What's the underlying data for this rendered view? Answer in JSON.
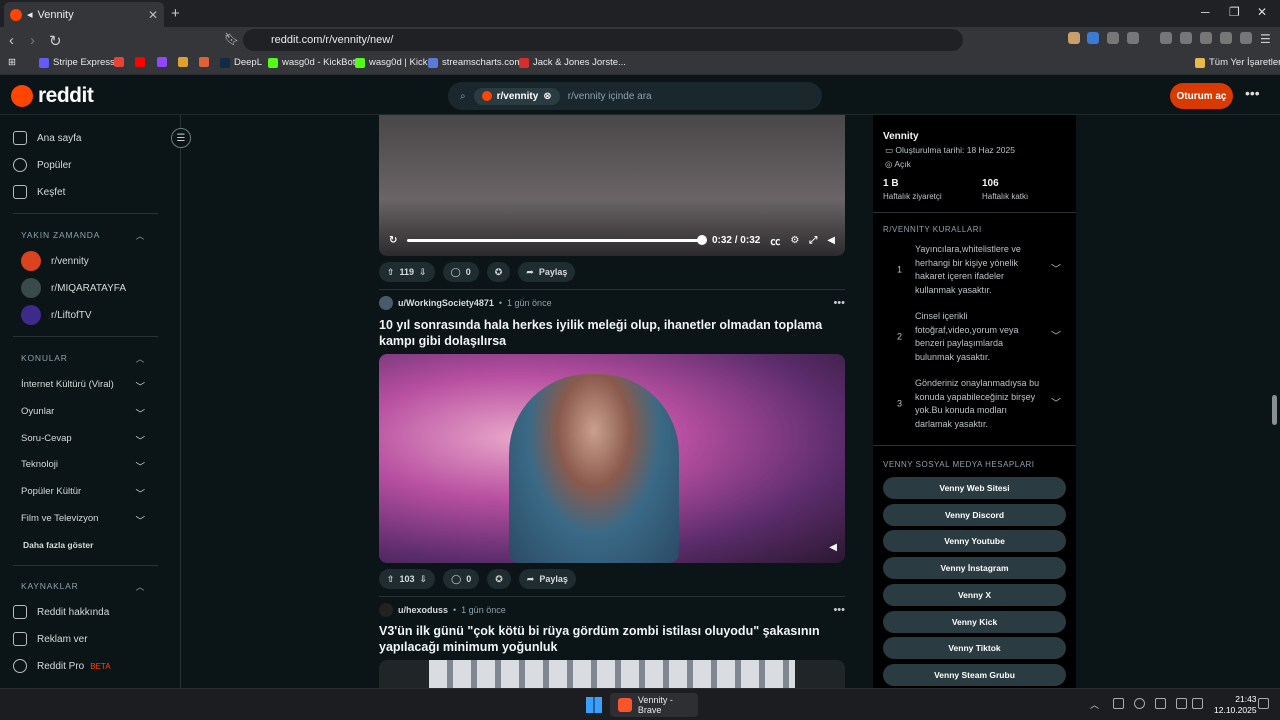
{
  "browser": {
    "tab_title": "Vennity",
    "url": "reddit.com/r/vennity/new/",
    "bookmarks": [
      "Stripe Express",
      "DeepL",
      "wasg0d - KickBot",
      "wasg0d | Kick",
      "streamscharts.com",
      "Jack & Jones Jorste...",
      "Tüm Yer İşaretleri"
    ]
  },
  "header": {
    "logo_text": "reddit",
    "search_chip": "r/vennity",
    "search_placeholder": "r/vennity içinde ara",
    "login_label": "Oturum aç"
  },
  "sidebar": {
    "nav": [
      "Ana sayfa",
      "Popüler",
      "Keşfet"
    ],
    "recent_title": "YAKIN ZAMANDA",
    "recent": [
      "r/vennity",
      "r/MIQARATAYFA",
      "r/LiftofTV"
    ],
    "topics_title": "KONULAR",
    "topics": [
      "İnternet Kültürü (Viral)",
      "Oyunlar",
      "Soru-Cevap",
      "Teknoloji",
      "Popüler Kültür",
      "Film ve Televizyon"
    ],
    "more_label": "Daha fazla göster",
    "resources_title": "KAYNAKLAR",
    "resources": [
      "Reddit hakkında",
      "Reklam ver",
      "Reddit Pro"
    ],
    "beta_label": "BETA"
  },
  "feed": {
    "video1_time": "0:32 / 0:32",
    "post1_votes": "119",
    "post1_comments": "0",
    "share_label": "Paylaş",
    "post2_author": "u/WorkingSociety4871",
    "post2_time": "1 gün önce",
    "post2_title": "10 yıl sonrasında hala herkes iyilik meleği olup, ihanetler olmadan toplama kampı gibi dolaşılırsa",
    "post2_votes": "103",
    "post2_comments": "0",
    "post3_author": "u/hexoduss",
    "post3_time": "1 gün önce",
    "post3_title": "V3'ün ilk günü \"çok kötü bi rüya gördüm zombi istilası oluyodu\" şakasının yapılacağı minimum yoğunluk"
  },
  "community": {
    "name": "Vennity",
    "created": "Oluşturulma tarihi: 18 Haz 2025",
    "visibility": "Açık",
    "visitors_value": "1 B",
    "visitors_label": "Haftalık ziyaretçi",
    "contrib_value": "106",
    "contrib_label": "Haftalık katkı",
    "rules_title": "R/VENNİTY KURALLARI",
    "rules": [
      "Yayıncılara,whitelistlere ve herhangi bir kişiye yönelik hakaret içeren ifadeler kullanmak yasaktır.",
      "Cinsel içerikli fotoğraf,video,yorum veya benzeri paylaşımlarda bulunmak yasaktır.",
      "Gönderiniz onaylanmadıysa bu konuda yapabileceğiniz birşey yok.Bu konuda modları darlamak yasaktır."
    ],
    "social_title": "VENNY SOSYAL MEDYA HESAPLARI",
    "social": [
      "Venny Web Sitesi",
      "Venny Discord",
      "Venny Youtube",
      "Venny İnstagram",
      "Venny X",
      "Venny Kick",
      "Venny Tiktok",
      "Venny Steam Grubu"
    ]
  },
  "taskbar": {
    "app_label": "Vennity - Brave",
    "time": "21:43",
    "date": "12.10.2025"
  }
}
